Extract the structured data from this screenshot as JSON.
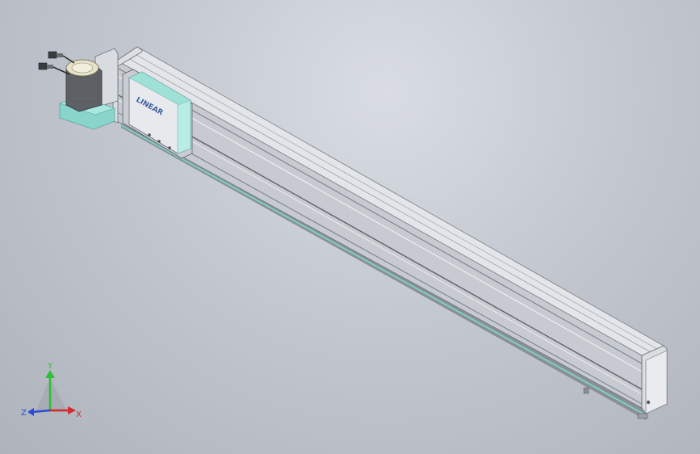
{
  "viewport": {
    "background_top": "#d9dde3",
    "background_bottom": "#aeb3bc"
  },
  "model": {
    "rail_body_color": "#c9ccd1",
    "rail_top_color": "#e4e6ea",
    "rail_side_color": "#b6bac1",
    "accent_color": "#8fd8cf",
    "motor_color": "#5b5e62",
    "carriage_logo_text": "LINEAR"
  },
  "triad": {
    "y_label": "Y",
    "x_label": "X",
    "z_label": "Z",
    "y_color": "#2fbf3a",
    "x_color": "#d22b2b",
    "z_color": "#2c4bd6"
  }
}
